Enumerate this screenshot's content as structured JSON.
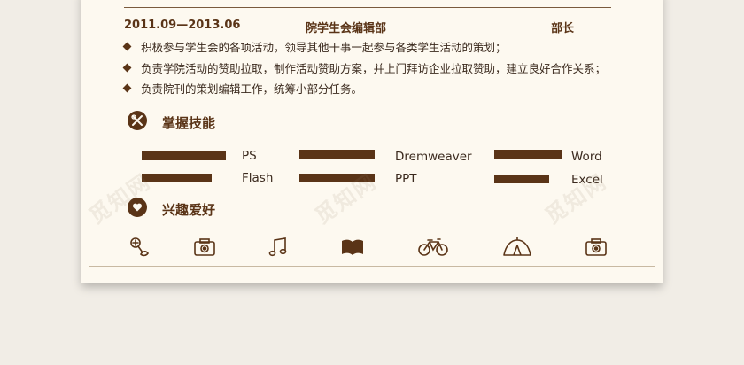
{
  "experience": {
    "date": "2011.09—2013.06",
    "organization": "院学生会编辑部",
    "role": "部长",
    "bullets": [
      "积极参与学生会的各项活动，领导其他干事一起参与各类学生活动的策划；",
      "负责学院活动的赞助拉取，制作活动赞助方案，并上门拜访企业拉取赞助，建立良好合作关系；",
      "负责院刊的策划编辑工作，统筹小部分任务。"
    ]
  },
  "skills": {
    "title": "掌握技能",
    "icon": "tools-icon",
    "items": [
      {
        "name": "PS",
        "level": 0.9
      },
      {
        "name": "Flash",
        "level": 0.75
      },
      {
        "name": "Dremweaver",
        "level": 0.85
      },
      {
        "name": "PPT",
        "level": 0.85
      },
      {
        "name": "Word",
        "level": 0.8
      },
      {
        "name": "Excel",
        "level": 0.65
      }
    ]
  },
  "hobbies": {
    "title": "兴趣爱好",
    "icon": "heart-icon",
    "items": [
      "badminton-icon",
      "camera-icon",
      "music-icon",
      "book-icon",
      "bicycle-icon",
      "tent-icon",
      "camera-icon"
    ]
  },
  "watermark": [
    "觅知网",
    "觅知网",
    "觅知网"
  ],
  "colors": {
    "accent": "#5a3417",
    "paper": "#fdf9f0",
    "background": "#f1ede6"
  }
}
